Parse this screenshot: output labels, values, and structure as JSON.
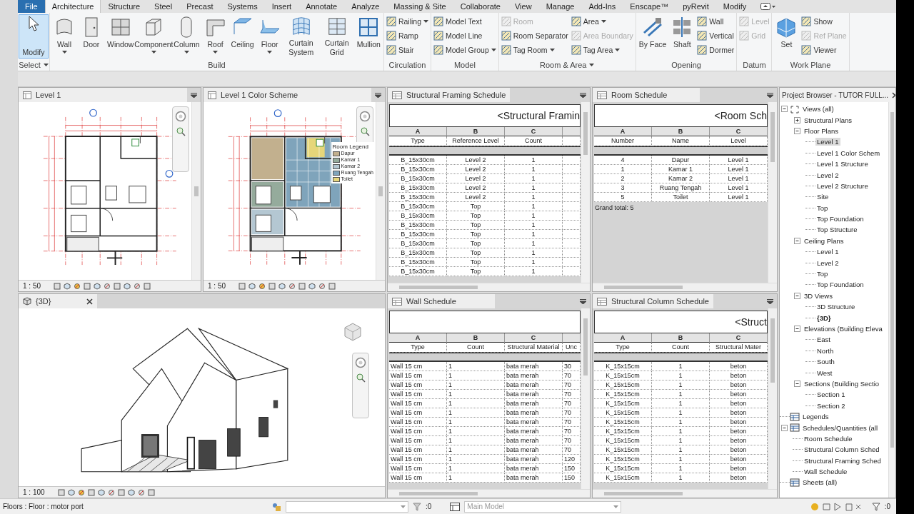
{
  "menu_tabs": [
    {
      "label": "File",
      "kind": "file",
      "selected": false
    },
    {
      "label": "Architecture",
      "kind": "tab",
      "selected": true
    },
    {
      "label": "Structure",
      "kind": "tab",
      "selected": false
    },
    {
      "label": "Steel",
      "kind": "tab",
      "selected": false
    },
    {
      "label": "Precast",
      "kind": "tab",
      "selected": false
    },
    {
      "label": "Systems",
      "kind": "tab",
      "selected": false
    },
    {
      "label": "Insert",
      "kind": "tab",
      "selected": false
    },
    {
      "label": "Annotate",
      "kind": "tab",
      "selected": false
    },
    {
      "label": "Analyze",
      "kind": "tab",
      "selected": false
    },
    {
      "label": "Massing & Site",
      "kind": "tab",
      "selected": false
    },
    {
      "label": "Collaborate",
      "kind": "tab",
      "selected": false
    },
    {
      "label": "View",
      "kind": "tab",
      "selected": false
    },
    {
      "label": "Manage",
      "kind": "tab",
      "selected": false
    },
    {
      "label": "Add-Ins",
      "kind": "tab",
      "selected": false
    },
    {
      "label": "Enscape™",
      "kind": "tab",
      "selected": false
    },
    {
      "label": "pyRevit",
      "kind": "tab",
      "selected": false
    },
    {
      "label": "Modify",
      "kind": "tab",
      "selected": false
    }
  ],
  "ribbon": {
    "panels": [
      {
        "title": "Select",
        "dropdown": true,
        "modify": {
          "label": "Modify",
          "active": true
        }
      },
      {
        "title": "Build",
        "dropdown": false,
        "tools": [
          {
            "label": "Wall",
            "kind": "large",
            "dropdown": true,
            "disabled": false
          },
          {
            "label": "Door",
            "kind": "large",
            "dropdown": false,
            "disabled": false
          },
          {
            "label": "Window",
            "kind": "large",
            "dropdown": false,
            "disabled": false
          },
          {
            "label": "Component",
            "kind": "large",
            "dropdown": true,
            "disabled": false
          },
          {
            "label": "Column",
            "kind": "large",
            "dropdown": true,
            "disabled": false
          },
          {
            "label": "Roof",
            "kind": "large",
            "dropdown": true,
            "disabled": false
          },
          {
            "label": "Ceiling",
            "kind": "large",
            "dropdown": false,
            "disabled": false
          },
          {
            "label": "Floor",
            "kind": "large",
            "dropdown": true,
            "disabled": false
          },
          {
            "label": "Curtain System",
            "kind": "large",
            "dropdown": false,
            "disabled": false
          },
          {
            "label": "Curtain Grid",
            "kind": "large",
            "dropdown": false,
            "disabled": false
          },
          {
            "label": "Mullion",
            "kind": "large",
            "dropdown": false,
            "disabled": false
          }
        ]
      },
      {
        "title": "Circulation",
        "dropdown": false,
        "tools": [
          {
            "label": "Railing",
            "kind": "small",
            "dropdown": true,
            "disabled": false
          },
          {
            "label": "Ramp",
            "kind": "small",
            "dropdown": false,
            "disabled": false
          },
          {
            "label": "Stair",
            "kind": "small",
            "dropdown": false,
            "disabled": false
          }
        ]
      },
      {
        "title": "Model",
        "dropdown": false,
        "tools": [
          {
            "label": "Model Text",
            "kind": "small",
            "dropdown": false,
            "disabled": false
          },
          {
            "label": "Model Line",
            "kind": "small",
            "dropdown": false,
            "disabled": false
          },
          {
            "label": "Model Group",
            "kind": "small",
            "dropdown": true,
            "disabled": false
          }
        ]
      },
      {
        "title": "Room & Area",
        "dropdown": true,
        "tools": [
          {
            "label": "Room",
            "kind": "small",
            "dropdown": false,
            "disabled": true
          },
          {
            "label": "Room Separator",
            "kind": "small",
            "dropdown": false,
            "disabled": false
          },
          {
            "label": "Tag Room",
            "kind": "small",
            "dropdown": true,
            "disabled": false
          },
          {
            "label": "Area",
            "kind": "small",
            "dropdown": true,
            "disabled": false
          },
          {
            "label": "Area Boundary",
            "kind": "small",
            "dropdown": false,
            "disabled": true
          },
          {
            "label": "Tag Area",
            "kind": "small",
            "dropdown": true,
            "disabled": false
          }
        ]
      },
      {
        "title": "Opening",
        "dropdown": false,
        "tools": [
          {
            "label": "By Face",
            "kind": "large",
            "dropdown": false,
            "disabled": false
          },
          {
            "label": "Shaft",
            "kind": "large",
            "dropdown": false,
            "disabled": false
          },
          {
            "label": "Wall",
            "kind": "small",
            "dropdown": false,
            "disabled": false
          },
          {
            "label": "Vertical",
            "kind": "small",
            "dropdown": false,
            "disabled": false
          },
          {
            "label": "Dormer",
            "kind": "small",
            "dropdown": false,
            "disabled": false
          }
        ]
      },
      {
        "title": "Datum",
        "dropdown": false,
        "tools": [
          {
            "label": "Level",
            "kind": "small",
            "dropdown": false,
            "disabled": true
          },
          {
            "label": "Grid",
            "kind": "small",
            "dropdown": false,
            "disabled": true
          }
        ]
      },
      {
        "title": "Work Plane",
        "dropdown": false,
        "tools": [
          {
            "label": "Set",
            "kind": "large",
            "dropdown": false,
            "disabled": false
          },
          {
            "label": "Show",
            "kind": "small",
            "dropdown": false,
            "disabled": false
          },
          {
            "label": "Ref Plane",
            "kind": "small",
            "dropdown": false,
            "disabled": true
          },
          {
            "label": "Viewer",
            "kind": "small",
            "dropdown": false,
            "disabled": false
          }
        ]
      }
    ]
  },
  "plan_views": [
    {
      "title": "Level 1",
      "scale": "1 : 50"
    },
    {
      "title": "Level 1 Color Scheme",
      "scale": "1 : 50",
      "legend": {
        "title": "Room Legend",
        "items": [
          {
            "label": "Dapur",
            "color": "#c2b08e"
          },
          {
            "label": "Kamar 1",
            "color": "#95ab9c"
          },
          {
            "label": "Kamar 2",
            "color": "#b4c7d2"
          },
          {
            "label": "Ruang Tengah",
            "color": "#7fa4bb"
          },
          {
            "label": "Toilet",
            "color": "#e6d67a"
          }
        ]
      }
    }
  ],
  "schedules": [
    {
      "title": "Structural Framing Schedule",
      "heading": "<Structural Framin",
      "left_aligned": false,
      "columns": [
        {
          "letter": "A",
          "name": "Type"
        },
        {
          "letter": "B",
          "name": "Reference Level"
        },
        {
          "letter": "C",
          "name": "Count"
        }
      ],
      "rows": [
        [
          "B_15x30cm",
          "Level 2",
          "1"
        ],
        [
          "B_15x30cm",
          "Level 2",
          "1"
        ],
        [
          "B_15x30cm",
          "Level 2",
          "1"
        ],
        [
          "B_15x30cm",
          "Level 2",
          "1"
        ],
        [
          "B_15x30cm",
          "Level 2",
          "1"
        ],
        [
          "B_15x30cm",
          "Top",
          "1"
        ],
        [
          "B_15x30cm",
          "Top",
          "1"
        ],
        [
          "B_15x30cm",
          "Top",
          "1"
        ],
        [
          "B_15x30cm",
          "Top",
          "1"
        ],
        [
          "B_15x30cm",
          "Top",
          "1"
        ],
        [
          "B_15x30cm",
          "Top",
          "1"
        ],
        [
          "B_15x30cm",
          "Top",
          "1"
        ],
        [
          "B_15x30cm",
          "Top",
          "1"
        ]
      ]
    },
    {
      "title": "Room Schedule",
      "heading": "<Room Sch",
      "left_aligned": false,
      "columns": [
        {
          "letter": "A",
          "name": "Number"
        },
        {
          "letter": "B",
          "name": "Name"
        },
        {
          "letter": "C",
          "name": "Level"
        }
      ],
      "rows": [
        [
          "4",
          "Dapur",
          "Level 1"
        ],
        [
          "1",
          "Kamar 1",
          "Level 1"
        ],
        [
          "2",
          "Kamar 2",
          "Level 1"
        ],
        [
          "3",
          "Ruang Tengah",
          "Level 1"
        ],
        [
          "5",
          "Toilet",
          "Level 1"
        ]
      ],
      "footer": "Grand total: 5"
    },
    {
      "title": "Wall Schedule",
      "left_aligned": true,
      "columns": [
        {
          "letter": "A",
          "name": "Type"
        },
        {
          "letter": "B",
          "name": "Count"
        },
        {
          "letter": "C",
          "name": "Structural Material"
        },
        {
          "name": "Unc"
        }
      ],
      "rows": [
        [
          "Wall 15 cm",
          "1",
          "bata merah",
          "30"
        ],
        [
          "Wall 15 cm",
          "1",
          "bata merah",
          "70"
        ],
        [
          "Wall 15 cm",
          "1",
          "bata merah",
          "70"
        ],
        [
          "Wall 15 cm",
          "1",
          "bata merah",
          "70"
        ],
        [
          "Wall 15 cm",
          "1",
          "bata merah",
          "70"
        ],
        [
          "Wall 15 cm",
          "1",
          "bata merah",
          "70"
        ],
        [
          "Wall 15 cm",
          "1",
          "bata merah",
          "70"
        ],
        [
          "Wall 15 cm",
          "1",
          "bata merah",
          "70"
        ],
        [
          "Wall 15 cm",
          "1",
          "bata merah",
          "70"
        ],
        [
          "Wall 15 cm",
          "1",
          "bata merah",
          "70"
        ],
        [
          "Wall 15 cm",
          "1",
          "bata merah",
          "120"
        ],
        [
          "Wall 15 cm",
          "1",
          "bata merah",
          "150"
        ],
        [
          "Wall 15 cm",
          "1",
          "bata merah",
          "150"
        ]
      ]
    },
    {
      "title": "Structural Column Schedule",
      "heading": "<Struct",
      "left_aligned": false,
      "columns": [
        {
          "letter": "A",
          "name": "Type"
        },
        {
          "letter": "B",
          "name": "Count"
        },
        {
          "letter": "C",
          "name": "Structural Mater"
        }
      ],
      "rows": [
        [
          "K_15x15cm",
          "1",
          "beton"
        ],
        [
          "K_15x15cm",
          "1",
          "beton"
        ],
        [
          "K_15x15cm",
          "1",
          "beton"
        ],
        [
          "K_15x15cm",
          "1",
          "beton"
        ],
        [
          "K_15x15cm",
          "1",
          "beton"
        ],
        [
          "K_15x15cm",
          "1",
          "beton"
        ],
        [
          "K_15x15cm",
          "1",
          "beton"
        ],
        [
          "K_15x15cm",
          "1",
          "beton"
        ],
        [
          "K_15x15cm",
          "1",
          "beton"
        ],
        [
          "K_15x15cm",
          "1",
          "beton"
        ],
        [
          "K_15x15cm",
          "1",
          "beton"
        ],
        [
          "K_15x15cm",
          "1",
          "beton"
        ],
        [
          "K_15x15cm",
          "1",
          "beton"
        ]
      ]
    }
  ],
  "view_3d": {
    "title": "{3D}",
    "scale": "1 : 100"
  },
  "project_browser": {
    "title": "Project Browser - TUTOR FULL...",
    "tree": [
      {
        "label": "Views (all)",
        "kind": "views",
        "expanded": true,
        "selected": false,
        "current": false,
        "children": [
          {
            "label": "Structural Plans",
            "expanded": false,
            "selected": false,
            "current": false
          },
          {
            "label": "Floor Plans",
            "expanded": true,
            "selected": false,
            "current": false,
            "children": [
              {
                "label": "Level 1",
                "selected": true,
                "current": false
              },
              {
                "label": "Level 1 Color Schem",
                "selected": false,
                "current": false
              },
              {
                "label": "Level 1 Structure",
                "selected": false,
                "current": false
              },
              {
                "label": "Level 2",
                "selected": false,
                "current": false
              },
              {
                "label": "Level 2 Structure",
                "selected": false,
                "current": false
              },
              {
                "label": "Site",
                "selected": false,
                "current": false
              },
              {
                "label": "Top",
                "selected": false,
                "current": false
              },
              {
                "label": "Top Foundation",
                "selected": false,
                "current": false
              },
              {
                "label": "Top Structure",
                "selected": false,
                "current": false
              }
            ]
          },
          {
            "label": "Ceiling Plans",
            "expanded": true,
            "selected": false,
            "current": false,
            "children": [
              {
                "label": "Level 1",
                "selected": false,
                "current": false
              },
              {
                "label": "Level 2",
                "selected": false,
                "current": false
              },
              {
                "label": "Top",
                "selected": false,
                "current": false
              },
              {
                "label": "Top Foundation",
                "selected": false,
                "current": false
              }
            ]
          },
          {
            "label": "3D Views",
            "expanded": true,
            "selected": false,
            "current": false,
            "children": [
              {
                "label": "3D Structure",
                "selected": false,
                "current": false
              },
              {
                "label": "{3D}",
                "selected": false,
                "current": true
              }
            ]
          },
          {
            "label": "Elevations (Building Eleva",
            "expanded": true,
            "selected": false,
            "current": false,
            "children": [
              {
                "label": "East",
                "selected": false,
                "current": false
              },
              {
                "label": "North",
                "selected": false,
                "current": false
              },
              {
                "label": "South",
                "selected": false,
                "current": false
              },
              {
                "label": "West",
                "selected": false,
                "current": false
              }
            ]
          },
          {
            "label": "Sections (Building Sectio",
            "expanded": true,
            "selected": false,
            "current": false,
            "children": [
              {
                "label": "Section 1",
                "selected": false,
                "current": false
              },
              {
                "label": "Section 2",
                "selected": false,
                "current": false
              }
            ]
          }
        ]
      },
      {
        "label": "Legends",
        "kind": "legends",
        "selected": false,
        "current": false
      },
      {
        "label": "Schedules/Quantities (all",
        "kind": "schedules",
        "expanded": true,
        "selected": false,
        "current": false,
        "children": [
          {
            "label": "Room Schedule",
            "selected": false,
            "current": false
          },
          {
            "label": "Structural Column Sched",
            "selected": false,
            "current": false
          },
          {
            "label": "Structural Framing Sched",
            "selected": false,
            "current": false
          },
          {
            "label": "Wall Schedule",
            "selected": false,
            "current": false
          }
        ]
      },
      {
        "label": "Sheets (all)",
        "kind": "sheets",
        "selected": false,
        "current": false
      }
    ]
  },
  "status_bar": {
    "selection": "Floors : Floor : motor port",
    "editable_count": ":0",
    "workset": "Main Model",
    "filter_count": ":0"
  }
}
